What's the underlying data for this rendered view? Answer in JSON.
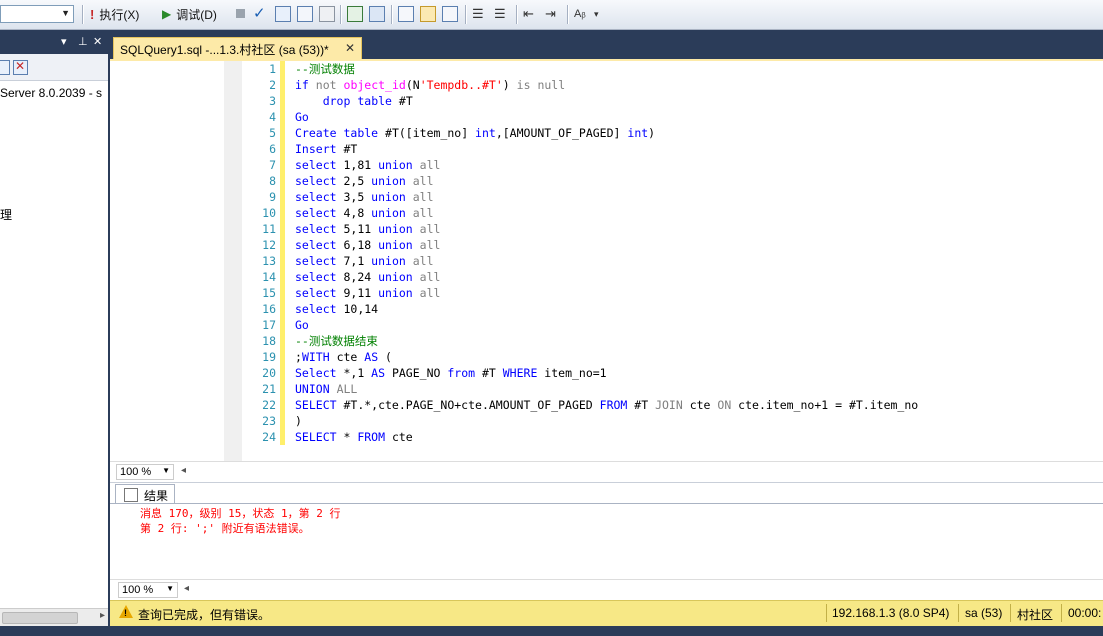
{
  "toolbar": {
    "db_selector": "",
    "execute_label": "执行(X)",
    "debug_label": "调试(D)"
  },
  "object_explorer": {
    "nodes": [
      "Server 8.0.2039 - s",
      "理"
    ]
  },
  "document_tab": {
    "title": "SQLQuery1.sql -...1.3.村社区 (sa (53))*",
    "close_glyph": "✕"
  },
  "editor": {
    "line_numbers": [
      "1",
      "2",
      "3",
      "4",
      "5",
      "6",
      "7",
      "8",
      "9",
      "10",
      "11",
      "12",
      "13",
      "14",
      "15",
      "16",
      "17",
      "18",
      "19",
      "20",
      "21",
      "22",
      "23",
      "24"
    ],
    "lines": [
      "--测试数据",
      "if not object_id(N'Tempdb..#T') is null",
      "    drop table #T",
      "Go",
      "Create table #T([item_no] int,[AMOUNT_OF_PAGED] int)",
      "Insert #T",
      "select 1,81 union all",
      "select 2,5 union all",
      "select 3,5 union all",
      "select 4,8 union all",
      "select 5,11 union all",
      "select 6,18 union all",
      "select 7,1 union all",
      "select 8,24 union all",
      "select 9,11 union all",
      "select 10,14",
      "Go",
      "--测试数据结束",
      ";WITH cte AS (",
      "Select *,1 AS PAGE_NO from #T WHERE item_no=1",
      "UNION ALL",
      "SELECT #T.*,cte.PAGE_NO+cte.AMOUNT_OF_PAGED FROM #T JOIN cte ON cte.item_no+1 = #T.item_no",
      ")",
      "SELECT * FROM cte"
    ],
    "zoom": "100 %"
  },
  "results": {
    "tab_label": "结果",
    "messages": [
      "消息 170，级别 15，状态 1，第 2 行",
      "第 2 行: ';' 附近有语法错误。"
    ],
    "zoom": "100 %"
  },
  "status_bar": {
    "message": "查询已完成，但有错误。",
    "server": "192.168.1.3 (8.0 SP4)",
    "user": "sa (53)",
    "database": "村社区",
    "time": "00:00:"
  },
  "colors": {
    "keyword": "#0000ff",
    "comment": "#008000",
    "string": "#ff0000",
    "error_text": "#ff0000",
    "tab_active": "#fdeaa8",
    "status_bar": "#f7e886",
    "chrome_dark": "#2b3c59"
  },
  "icons": [
    "execute-icon",
    "debug-icon",
    "stop-icon",
    "parse-icon",
    "warning-icon",
    "close-icon",
    "pin-icon",
    "results-grid-icon"
  ]
}
